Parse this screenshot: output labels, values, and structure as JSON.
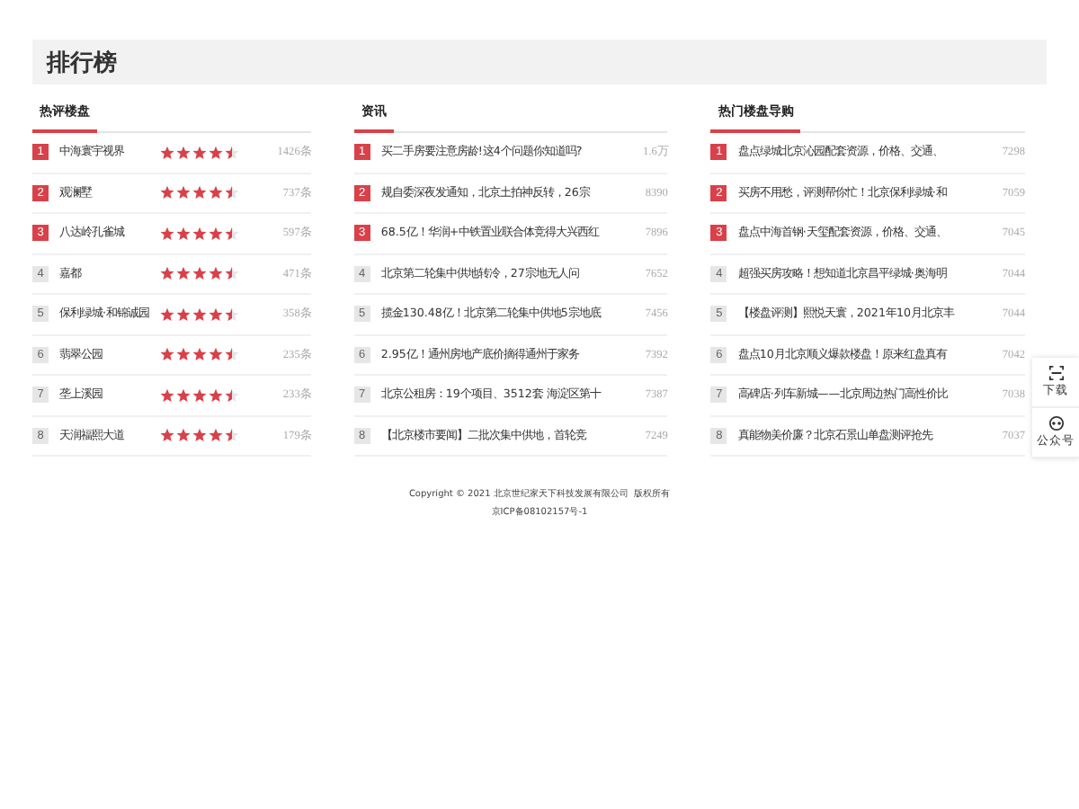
{
  "page_title": "排行榜",
  "columns": [
    {
      "title": "热评楼盘",
      "kind": "rated",
      "rows": [
        {
          "rank": "1",
          "name": "中海寰宇视界",
          "stars": 4.5,
          "count": "1426条"
        },
        {
          "rank": "2",
          "name": "观澜墅",
          "stars": 4.5,
          "count": "737条"
        },
        {
          "rank": "3",
          "name": "八达岭孔雀城",
          "stars": 4.5,
          "count": "597条"
        },
        {
          "rank": "4",
          "name": "嘉都",
          "stars": 4.5,
          "count": "471条"
        },
        {
          "rank": "5",
          "name": "保利绿城·和锦诚园",
          "stars": 4.5,
          "count": "358条"
        },
        {
          "rank": "6",
          "name": "翡翠公园",
          "stars": 4.5,
          "count": "235条"
        },
        {
          "rank": "7",
          "name": "垄上溪园",
          "stars": 4.5,
          "count": "233条"
        },
        {
          "rank": "8",
          "name": "天润福熙大道",
          "stars": 4.5,
          "count": "179条"
        }
      ]
    },
    {
      "title": "资讯",
      "kind": "article",
      "rows": [
        {
          "rank": "1",
          "name": "买二手房要注意房龄!这4个问题你知道吗?",
          "count": "1.6万"
        },
        {
          "rank": "2",
          "name": "规自委深夜发通知，北京土拍神反转，26宗",
          "count": "8390"
        },
        {
          "rank": "3",
          "name": "68.5亿！华润+中铁置业联合体竞得大兴西红",
          "count": "7896"
        },
        {
          "rank": "4",
          "name": "北京第二轮集中供地转冷，27宗地无人问",
          "count": "7652"
        },
        {
          "rank": "5",
          "name": "揽金130.48亿！北京第二轮集中供地5宗地底",
          "count": "7456"
        },
        {
          "rank": "6",
          "name": "2.95亿！通州房地产底价摘得通州于家务",
          "count": "7392"
        },
        {
          "rank": "7",
          "name": "北京公租房：19个项目、3512套 海淀区第十",
          "count": "7387"
        },
        {
          "rank": "8",
          "name": "【北京楼市要闻】二批次集中供地，首轮竞",
          "count": "7249"
        }
      ]
    },
    {
      "title": "热门楼盘导购",
      "kind": "article",
      "rows": [
        {
          "rank": "1",
          "name": "盘点绿城北京沁园配套资源，价格、交通、",
          "count": "7298"
        },
        {
          "rank": "2",
          "name": "买房不用愁，评测帮你忙！北京保利绿城·和",
          "count": "7059"
        },
        {
          "rank": "3",
          "name": "盘点中海首钢·天玺配套资源，价格、交通、",
          "count": "7045"
        },
        {
          "rank": "4",
          "name": "超强买房攻略！想知道北京昌平绿城·奥海明",
          "count": "7044"
        },
        {
          "rank": "5",
          "name": "【楼盘评测】熙悦天寰，2021年10月北京丰",
          "count": "7044"
        },
        {
          "rank": "6",
          "name": "盘点10月北京顺义爆款楼盘！原来红盘真有",
          "count": "7042"
        },
        {
          "rank": "7",
          "name": "高碑店·列车新城——北京周边热门高性价比",
          "count": "7038"
        },
        {
          "rank": "8",
          "name": "真能物美价廉？北京石景山单盘测评抢先",
          "count": "7037"
        }
      ]
    }
  ],
  "footer": {
    "copyright": "Copyright © 2021 北京世纪家天下科技发展有限公司  版权所有",
    "icp": "京ICP备08102157号-1"
  },
  "side_widget": [
    {
      "label": "下载",
      "kind": "scan"
    },
    {
      "label": "公众号",
      "kind": "chat"
    }
  ]
}
